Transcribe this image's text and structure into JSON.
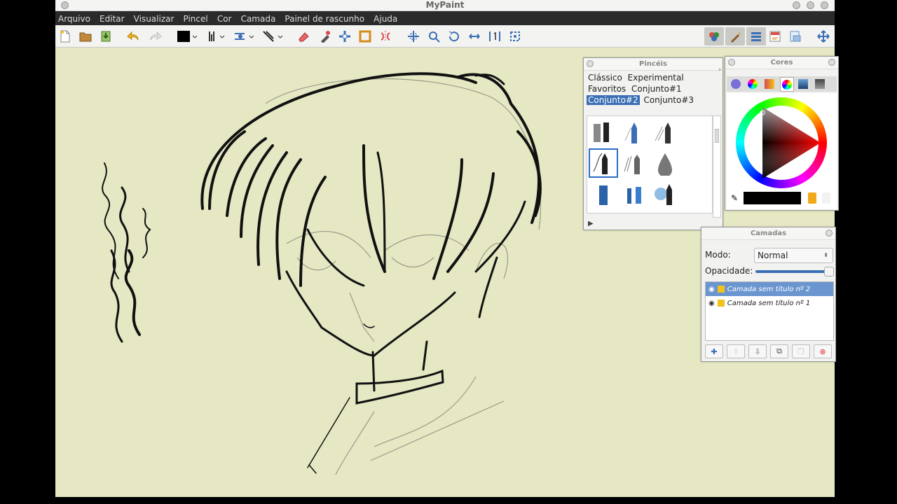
{
  "window": {
    "title": "MyPaint"
  },
  "menu": [
    "Arquivo",
    "Editar",
    "Visualizar",
    "Pincel",
    "Cor",
    "Camada",
    "Painel de rascunho",
    "Ajuda"
  ],
  "brushes_panel": {
    "title": "Pincéis",
    "groups": [
      "Clássico",
      "Experimental",
      "Favoritos",
      "Conjunto#1",
      "Conjunto#2",
      "Conjunto#3"
    ],
    "selected_group": "Conjunto#2"
  },
  "colors_panel": {
    "title": "Cores",
    "current_color": "#000000"
  },
  "layers_panel": {
    "title": "Camadas",
    "mode_label": "Modo:",
    "mode_value": "Normal",
    "opacity_label": "Opacidade:",
    "opacity": 1.0,
    "layers": [
      "Camada sem título nº 2",
      "Camada sem título nº 1"
    ],
    "selected_layer": "Camada sem título nº 2"
  },
  "colors": {
    "canvas": "#e6e8c3",
    "menubar": "#2b2b2b",
    "selection": "#3b6fb5",
    "layer_selection": "#6a95cf"
  }
}
